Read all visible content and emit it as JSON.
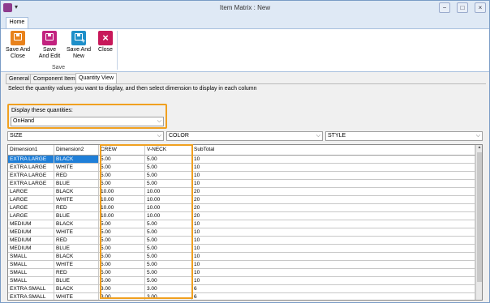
{
  "window": {
    "title": "Item Matrix : New",
    "qat_glyph": "▾",
    "min": "−",
    "restore": "□",
    "close": "×"
  },
  "ribbon": {
    "tab": "Home",
    "buttons": [
      {
        "l1": "Save And",
        "l2": "Close"
      },
      {
        "l1": "Save",
        "l2": "And Edit"
      },
      {
        "l1": "Save And",
        "l2": "New"
      },
      {
        "l1": "Close",
        "l2": ""
      }
    ],
    "group": "Save"
  },
  "tabs": [
    "General",
    "Component Item",
    "Quantity View"
  ],
  "hint": "Select the quantity values you want to display, and then select dimension to display in each column",
  "quantities": {
    "label": "Display these quantities:",
    "value": "OnHand"
  },
  "dim_selects": [
    "SIZE",
    "COLOR",
    "STYLE"
  ],
  "grid": {
    "columns": [
      "Dimension1",
      "Dimension2",
      "CREW",
      "V-NECK",
      "SubTotal"
    ],
    "rows": [
      [
        "EXTRA LARGE",
        "BLACK",
        "5.00",
        "5.00",
        "10"
      ],
      [
        "EXTRA LARGE",
        "WHITE",
        "5.00",
        "5.00",
        "10"
      ],
      [
        "EXTRA LARGE",
        "RED",
        "5.00",
        "5.00",
        "10"
      ],
      [
        "EXTRA LARGE",
        "BLUE",
        "5.00",
        "5.00",
        "10"
      ],
      [
        "LARGE",
        "BLACK",
        "10.00",
        "10.00",
        "20"
      ],
      [
        "LARGE",
        "WHITE",
        "10.00",
        "10.00",
        "20"
      ],
      [
        "LARGE",
        "RED",
        "10.00",
        "10.00",
        "20"
      ],
      [
        "LARGE",
        "BLUE",
        "10.00",
        "10.00",
        "20"
      ],
      [
        "MEDIUM",
        "BLACK",
        "5.00",
        "5.00",
        "10"
      ],
      [
        "MEDIUM",
        "WHITE",
        "5.00",
        "5.00",
        "10"
      ],
      [
        "MEDIUM",
        "RED",
        "5.00",
        "5.00",
        "10"
      ],
      [
        "MEDIUM",
        "BLUE",
        "5.00",
        "5.00",
        "10"
      ],
      [
        "SMALL",
        "BLACK",
        "5.00",
        "5.00",
        "10"
      ],
      [
        "SMALL",
        "WHITE",
        "5.00",
        "5.00",
        "10"
      ],
      [
        "SMALL",
        "RED",
        "5.00",
        "5.00",
        "10"
      ],
      [
        "SMALL",
        "BLUE",
        "5.00",
        "5.00",
        "10"
      ],
      [
        "EXTRA SMALL",
        "BLACK",
        "3.00",
        "3.00",
        "6"
      ],
      [
        "EXTRA SMALL",
        "WHITE",
        "3.00",
        "3.00",
        "6"
      ]
    ]
  },
  "colors": {
    "accent_highlight": "#f0a020",
    "selection": "#1f7fd8"
  }
}
